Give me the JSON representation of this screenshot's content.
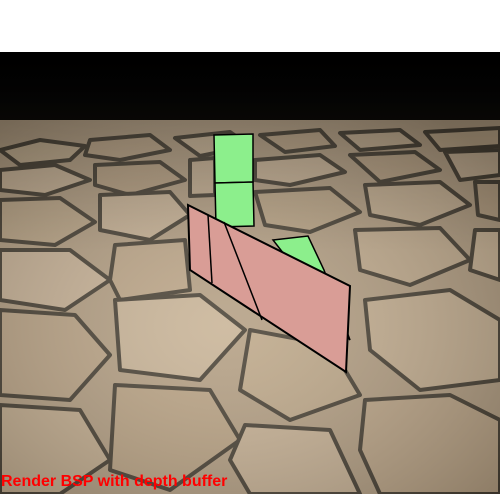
{
  "caption": "Render BSP with depth buffer",
  "colors": {
    "caption": "#ff0000",
    "background_top": "#ffffff",
    "sky": "#000000",
    "floor_base": "#b8a386",
    "floor_cracks": "#4a4236",
    "green_block": "#8cef8c",
    "pink_wall": "#d99d96",
    "edge": "#000000"
  },
  "scene": {
    "floor_texture": "cobblestone",
    "objects": [
      "green-cube-top",
      "green-cube-bottom",
      "green-slanted-panel",
      "pink-wall"
    ]
  }
}
